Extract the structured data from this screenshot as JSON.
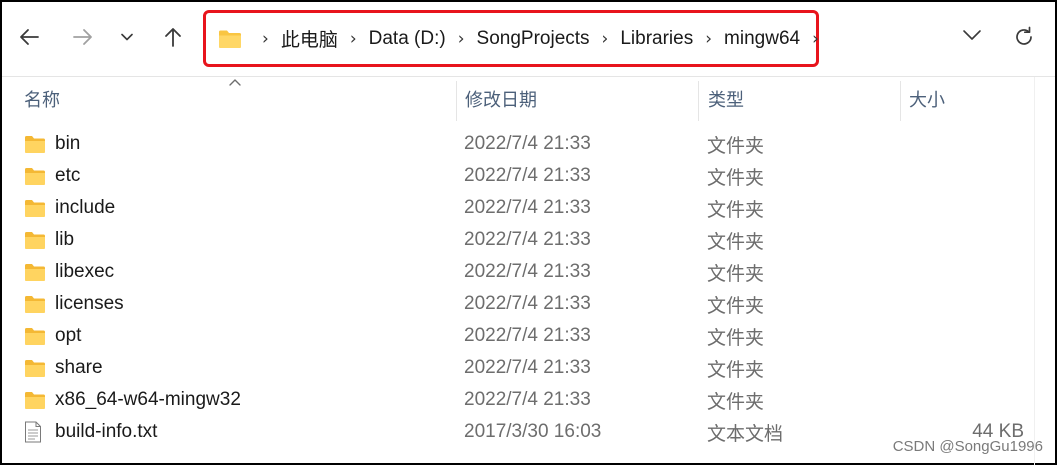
{
  "nav": {
    "back_icon": "arrow-left-icon",
    "forward_icon": "arrow-right-icon",
    "recent_icon": "chevron-down-icon",
    "up_icon": "arrow-up-icon"
  },
  "address_bar": {
    "folder_icon": "folder-icon",
    "crumbs": [
      "此电脑",
      "Data (D:)",
      "SongProjects",
      "Libraries",
      "mingw64"
    ],
    "highlight_color": "#e8141c"
  },
  "columns": {
    "name": "名称",
    "date": "修改日期",
    "type": "类型",
    "size": "大小"
  },
  "files": [
    {
      "name": "bin",
      "date": "2022/7/4 21:33",
      "type": "文件夹",
      "size": "",
      "icon": "folder-icon"
    },
    {
      "name": "etc",
      "date": "2022/7/4 21:33",
      "type": "文件夹",
      "size": "",
      "icon": "folder-icon"
    },
    {
      "name": "include",
      "date": "2022/7/4 21:33",
      "type": "文件夹",
      "size": "",
      "icon": "folder-icon"
    },
    {
      "name": "lib",
      "date": "2022/7/4 21:33",
      "type": "文件夹",
      "size": "",
      "icon": "folder-icon"
    },
    {
      "name": "libexec",
      "date": "2022/7/4 21:33",
      "type": "文件夹",
      "size": "",
      "icon": "folder-icon"
    },
    {
      "name": "licenses",
      "date": "2022/7/4 21:33",
      "type": "文件夹",
      "size": "",
      "icon": "folder-icon"
    },
    {
      "name": "opt",
      "date": "2022/7/4 21:33",
      "type": "文件夹",
      "size": "",
      "icon": "folder-icon"
    },
    {
      "name": "share",
      "date": "2022/7/4 21:33",
      "type": "文件夹",
      "size": "",
      "icon": "folder-icon"
    },
    {
      "name": "x86_64-w64-mingw32",
      "date": "2022/7/4 21:33",
      "type": "文件夹",
      "size": "",
      "icon": "folder-icon"
    },
    {
      "name": "build-info.txt",
      "date": "2017/3/30 16:03",
      "type": "文本文档",
      "size": "44 KB",
      "icon": "text-file-icon"
    }
  ],
  "watermark": "CSDN @SongGu1996"
}
